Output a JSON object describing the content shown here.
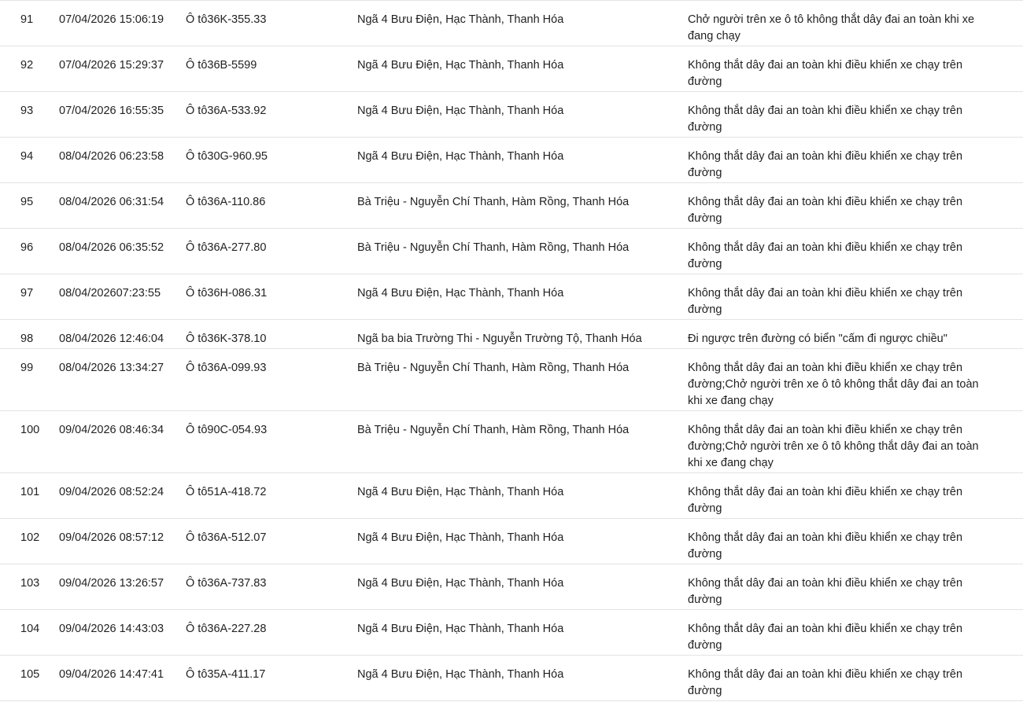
{
  "rows": [
    {
      "stt": "91",
      "time": "07/04/2026 15:06:19",
      "plate": "Ô tô36K-355.33",
      "location": "Ngã 4 Bưu Điện, Hạc Thành, Thanh Hóa",
      "violation": [
        "Chở người trên xe ô tô không thắt dây đai an toàn khi xe",
        "đang chạy"
      ]
    },
    {
      "stt": "92",
      "time": "07/04/2026 15:29:37",
      "plate": "Ô tô36B-5599",
      "location": "Ngã 4 Bưu Điện, Hạc Thành, Thanh Hóa",
      "violation": [
        "Không thắt dây đai an toàn khi điều khiển xe chạy trên",
        "đường"
      ]
    },
    {
      "stt": "93",
      "time": "07/04/2026 16:55:35",
      "plate": "Ô tô36A-533.92",
      "location": "Ngã 4 Bưu Điện, Hạc Thành, Thanh Hóa",
      "violation": [
        "Không thắt dây đai an toàn khi điều khiển xe chạy trên",
        "đường"
      ]
    },
    {
      "stt": "94",
      "time": "08/04/2026 06:23:58",
      "plate": "Ô tô30G-960.95",
      "location": "Ngã 4 Bưu Điện, Hạc Thành, Thanh Hóa",
      "violation": [
        "Không thắt dây đai an toàn khi điều khiển xe chạy trên",
        "đường"
      ]
    },
    {
      "stt": "95",
      "time": "08/04/2026 06:31:54",
      "plate": "Ô tô36A-110.86",
      "location": "Bà Triệu - Nguyễn Chí Thanh, Hàm Rồng, Thanh Hóa",
      "violation": [
        "Không thắt dây đai an toàn khi điều khiển xe chạy trên",
        "đường"
      ]
    },
    {
      "stt": "96",
      "time": "08/04/2026 06:35:52",
      "plate": "Ô tô36A-277.80",
      "location": "Bà Triệu - Nguyễn Chí Thanh, Hàm Rồng, Thanh Hóa",
      "violation": [
        "Không thắt dây đai an toàn khi điều khiển xe chạy trên",
        "đường"
      ]
    },
    {
      "stt": "97",
      "time": "08/04/202607:23:55",
      "plate": "Ô tô36H-086.31",
      "location": "Ngã 4 Bưu Điện, Hạc Thành, Thanh Hóa",
      "violation": [
        "Không thắt dây đai an toàn khi điều khiển xe chạy trên",
        "đường"
      ]
    },
    {
      "stt": "98",
      "time": "08/04/2026 12:46:04",
      "plate": "Ô tô36K-378.10",
      "location": "Ngã ba bia Trường Thi - Nguyễn Trường Tộ, Thanh Hóa",
      "violation": [
        "Đi ngược trên đường có biển \"cấm đi ngược chiều\""
      ]
    },
    {
      "stt": "99",
      "time": "08/04/2026 13:34:27",
      "plate": "Ô tô36A-099.93",
      "location": "Bà Triệu - Nguyễn Chí Thanh, Hàm Rồng, Thanh Hóa",
      "violation": [
        "Không thắt dây đai an toàn khi điều khiển xe chạy trên",
        "đường;Chở người trên xe ô tô không thắt dây đai an toàn",
        "khi xe đang chạy"
      ]
    },
    {
      "stt": "100",
      "time": "09/04/2026 08:46:34",
      "plate": "Ô tô90C-054.93",
      "location": "Bà Triệu - Nguyễn Chí Thanh, Hàm Rồng, Thanh Hóa",
      "violation": [
        "Không thắt dây đai an toàn khi điều khiển xe chạy trên",
        "đường;Chở người trên xe ô tô không thắt dây đai an toàn",
        "khi xe đang chạy"
      ]
    },
    {
      "stt": "101",
      "time": "09/04/2026 08:52:24",
      "plate": "Ô tô51A-418.72",
      "location": "Ngã 4 Bưu Điện, Hạc Thành, Thanh Hóa",
      "violation": [
        "Không thắt dây đai an toàn khi điều khiển xe chạy trên",
        "đường"
      ]
    },
    {
      "stt": "102",
      "time": "09/04/2026 08:57:12",
      "plate": "Ô tô36A-512.07",
      "location": "Ngã 4 Bưu Điện, Hạc Thành, Thanh Hóa",
      "violation": [
        "Không thắt dây đai an toàn khi điều khiển xe chạy trên",
        "đường"
      ]
    },
    {
      "stt": "103",
      "time": "09/04/2026 13:26:57",
      "plate": "Ô tô36A-737.83",
      "location": "Ngã 4 Bưu Điện, Hạc Thành, Thanh Hóa",
      "violation": [
        "Không thắt dây đai an toàn khi điều khiển xe chạy trên",
        "đường"
      ]
    },
    {
      "stt": "104",
      "time": "09/04/2026 14:43:03",
      "plate": "Ô tô36A-227.28",
      "location": "Ngã 4 Bưu Điện, Hạc Thành, Thanh Hóa",
      "violation": [
        "Không thắt dây đai an toàn khi điều khiển xe chạy trên",
        "đường"
      ]
    },
    {
      "stt": "105",
      "time": "09/04/2026 14:47:41",
      "plate": "Ô tô35A-411.17",
      "location": "Ngã 4 Bưu Điện, Hạc Thành, Thanh Hóa",
      "violation": [
        "Không thắt dây đai an toàn khi điều khiển xe chạy trên",
        "đường"
      ]
    }
  ]
}
